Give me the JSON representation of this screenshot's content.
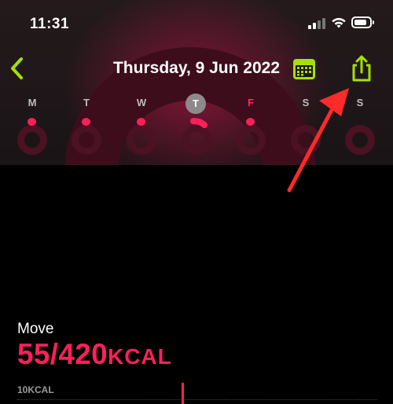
{
  "status_bar": {
    "time": "11:31"
  },
  "nav": {
    "title": "Thursday, 9 Jun 2022",
    "accent_color": "#a5e000"
  },
  "week": {
    "days": [
      {
        "letter": "M",
        "state": "past"
      },
      {
        "letter": "T",
        "state": "past"
      },
      {
        "letter": "W",
        "state": "past"
      },
      {
        "letter": "T",
        "state": "selected"
      },
      {
        "letter": "F",
        "state": "highlighted"
      },
      {
        "letter": "S",
        "state": "future"
      },
      {
        "letter": "S",
        "state": "future"
      }
    ]
  },
  "move": {
    "label": "Move",
    "value": "55/420",
    "unit": "KCAL",
    "progress_fraction": 0.131,
    "color": "#ff1f5a"
  },
  "graph": {
    "scale_label": "10KCAL"
  },
  "icons": {
    "back": "chevron-left-icon",
    "calendar": "calendar-icon",
    "share": "share-icon",
    "annotation": "red-arrow-annotation"
  }
}
